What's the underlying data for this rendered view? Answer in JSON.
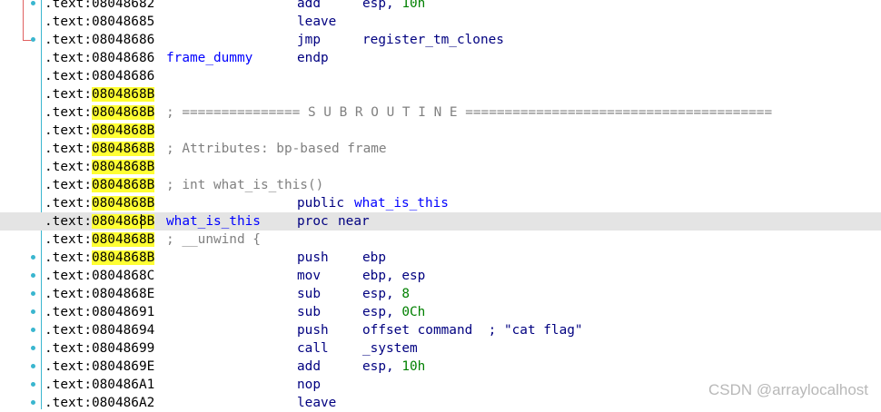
{
  "disassembly": {
    "rows": [
      {
        "prefix": ".text:",
        "addr": "08048682",
        "highlight": false,
        "mnem": "add",
        "op1": "esp, ",
        "op1num": "10h"
      },
      {
        "prefix": ".text:",
        "addr": "08048685",
        "highlight": false,
        "mnem": "leave"
      },
      {
        "prefix": ".text:",
        "addr": "08048686",
        "highlight": false,
        "mnem": "jmp",
        "op1": "register_tm_clones"
      },
      {
        "prefix": ".text:",
        "addr": "08048686",
        "highlight": false,
        "label": "frame_dummy",
        "mnem": "endp"
      },
      {
        "prefix": ".text:",
        "addr": "08048686",
        "highlight": false
      },
      {
        "prefix": ".text:",
        "addr": "0804868B",
        "highlight": true
      },
      {
        "prefix": ".text:",
        "addr": "0804868B",
        "highlight": true,
        "comment": "; =============== S U B R O U T I N E ======================================="
      },
      {
        "prefix": ".text:",
        "addr": "0804868B",
        "highlight": true
      },
      {
        "prefix": ".text:",
        "addr": "0804868B",
        "highlight": true,
        "comment": "; Attributes: bp-based frame"
      },
      {
        "prefix": ".text:",
        "addr": "0804868B",
        "highlight": true
      },
      {
        "prefix": ".text:",
        "addr": "0804868B",
        "highlight": true,
        "comment": "; int what_is_this()"
      },
      {
        "prefix": ".text:",
        "addr": "0804868B",
        "highlight": true,
        "mnem": "public",
        "op0": "what_is_this"
      },
      {
        "prefix": ".text:",
        "addr": "0804868B",
        "highlight": true,
        "current": true,
        "label": "what_is_this",
        "mnem": "proc",
        "op0": "near"
      },
      {
        "prefix": ".text:",
        "addr": "0804868B",
        "highlight": true,
        "comment": "; __unwind {"
      },
      {
        "prefix": ".text:",
        "addr": "0804868B",
        "highlight": true,
        "mnem": "push",
        "op1": "ebp"
      },
      {
        "prefix": ".text:",
        "addr": "0804868C",
        "highlight": false,
        "mnem": "mov",
        "op1": "ebp, esp"
      },
      {
        "prefix": ".text:",
        "addr": "0804868E",
        "highlight": false,
        "mnem": "sub",
        "op1": "esp, ",
        "op1num": "8"
      },
      {
        "prefix": ".text:",
        "addr": "08048691",
        "highlight": false,
        "mnem": "sub",
        "op1": "esp, ",
        "op1num": "0Ch"
      },
      {
        "prefix": ".text:",
        "addr": "08048694",
        "highlight": false,
        "mnem": "push",
        "op1": "offset command",
        "tail": "  ; \"cat flag\""
      },
      {
        "prefix": ".text:",
        "addr": "08048699",
        "highlight": false,
        "mnem": "call",
        "op1": "_system"
      },
      {
        "prefix": ".text:",
        "addr": "0804869E",
        "highlight": false,
        "mnem": "add",
        "op1": "esp, ",
        "op1num": "10h"
      },
      {
        "prefix": ".text:",
        "addr": "080486A1",
        "highlight": false,
        "mnem": "nop"
      },
      {
        "prefix": ".text:",
        "addr": "080486A2",
        "highlight": false,
        "mnem": "leave"
      }
    ]
  },
  "gutter_dot_rows": [
    0,
    2,
    14,
    15,
    16,
    17,
    18,
    19,
    20,
    21,
    22
  ],
  "watermark": "CSDN @arraylocalhost",
  "colors": {
    "address": "#000000",
    "address_highlight": "#ffff33",
    "label": "#0000ff",
    "instruction": "#000080",
    "number": "#008000",
    "comment": "#808080",
    "current_line": "#e4e4e4",
    "gutter_dot": "#3ab6cf"
  }
}
